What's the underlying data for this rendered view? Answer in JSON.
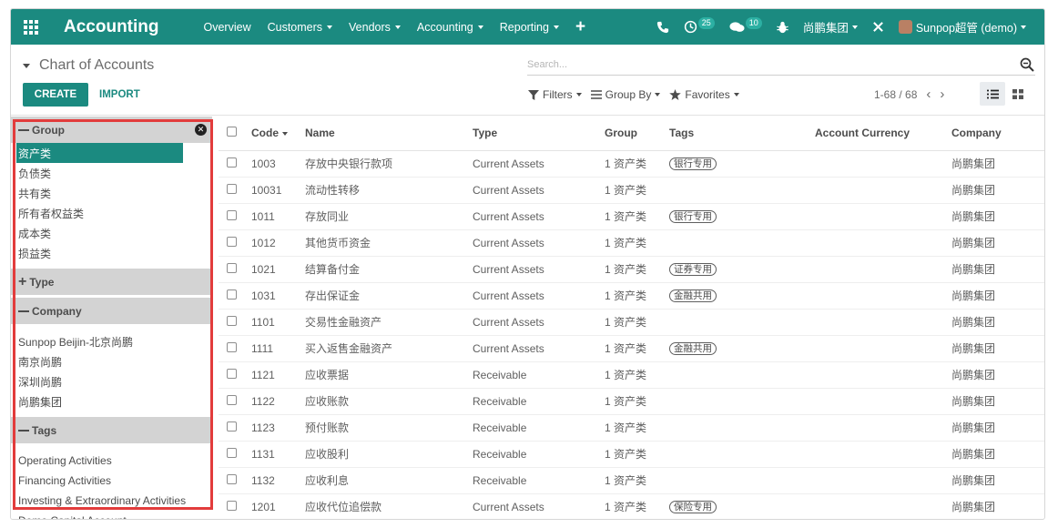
{
  "navbar": {
    "app_title": "Accounting",
    "menu": [
      "Overview",
      "Customers",
      "Vendors",
      "Accounting",
      "Reporting"
    ],
    "menu_has_caret": [
      false,
      true,
      true,
      true,
      true
    ],
    "activity_count": "25",
    "messages_count": "10",
    "company": "尚鹏集团",
    "user": "Sunpop超管 (demo)"
  },
  "control_panel": {
    "breadcrumb": "Chart of Accounts",
    "search_placeholder": "Search...",
    "create_label": "CREATE",
    "import_label": "IMPORT",
    "filters_label": "Filters",
    "groupby_label": "Group By",
    "favorites_label": "Favorites",
    "pager": "1-68 / 68"
  },
  "side_panel": {
    "group_header": "Group",
    "group_items": [
      "资产类",
      "负债类",
      "共有类",
      "所有者权益类",
      "成本类",
      "损益类"
    ],
    "group_active_index": 0,
    "type_header": "Type",
    "company_header": "Company",
    "company_items": [
      "Sunpop Beijin-北京尚鹏",
      "南京尚鹏",
      "深圳尚鹏",
      "尚鹏集团"
    ],
    "tags_header": "Tags",
    "tags_items": [
      "Operating Activities",
      "Financing Activities",
      "Investing & Extraordinary Activities",
      "Demo Capital Account"
    ]
  },
  "table": {
    "columns": [
      "Code",
      "Name",
      "Type",
      "Group",
      "Tags",
      "Account Currency",
      "Company"
    ],
    "rows": [
      {
        "code": "1003",
        "name": "存放中央银行款项",
        "type": "Current Assets",
        "group": "1 资产类",
        "tag": "银行专用",
        "currency": "",
        "company": "尚鹏集团"
      },
      {
        "code": "10031",
        "name": "流动性转移",
        "type": "Current Assets",
        "group": "1 资产类",
        "tag": "",
        "currency": "",
        "company": "尚鹏集团"
      },
      {
        "code": "1011",
        "name": "存放同业",
        "type": "Current Assets",
        "group": "1 资产类",
        "tag": "银行专用",
        "currency": "",
        "company": "尚鹏集团"
      },
      {
        "code": "1012",
        "name": "其他货币资金",
        "type": "Current Assets",
        "group": "1 资产类",
        "tag": "",
        "currency": "",
        "company": "尚鹏集团"
      },
      {
        "code": "1021",
        "name": "结算备付金",
        "type": "Current Assets",
        "group": "1 资产类",
        "tag": "证券专用",
        "currency": "",
        "company": "尚鹏集团"
      },
      {
        "code": "1031",
        "name": "存出保证金",
        "type": "Current Assets",
        "group": "1 资产类",
        "tag": "金融共用",
        "currency": "",
        "company": "尚鹏集团"
      },
      {
        "code": "1101",
        "name": "交易性金融资产",
        "type": "Current Assets",
        "group": "1 资产类",
        "tag": "",
        "currency": "",
        "company": "尚鹏集团"
      },
      {
        "code": "1111",
        "name": "买入返售金融资产",
        "type": "Current Assets",
        "group": "1 资产类",
        "tag": "金融共用",
        "currency": "",
        "company": "尚鹏集团"
      },
      {
        "code": "1121",
        "name": "应收票据",
        "type": "Receivable",
        "group": "1 资产类",
        "tag": "",
        "currency": "",
        "company": "尚鹏集团"
      },
      {
        "code": "1122",
        "name": "应收账款",
        "type": "Receivable",
        "group": "1 资产类",
        "tag": "",
        "currency": "",
        "company": "尚鹏集团"
      },
      {
        "code": "1123",
        "name": "预付账款",
        "type": "Receivable",
        "group": "1 资产类",
        "tag": "",
        "currency": "",
        "company": "尚鹏集团"
      },
      {
        "code": "1131",
        "name": "应收股利",
        "type": "Receivable",
        "group": "1 资产类",
        "tag": "",
        "currency": "",
        "company": "尚鹏集团"
      },
      {
        "code": "1132",
        "name": "应收利息",
        "type": "Receivable",
        "group": "1 资产类",
        "tag": "",
        "currency": "",
        "company": "尚鹏集团"
      },
      {
        "code": "1201",
        "name": "应收代位追偿款",
        "type": "Current Assets",
        "group": "1 资产类",
        "tag": "保险专用",
        "currency": "",
        "company": "尚鹏集团"
      }
    ]
  },
  "colors": {
    "brand": "#1b8a80",
    "highlight_border": "#e23c3c",
    "panel_header": "#d3d3d3"
  }
}
